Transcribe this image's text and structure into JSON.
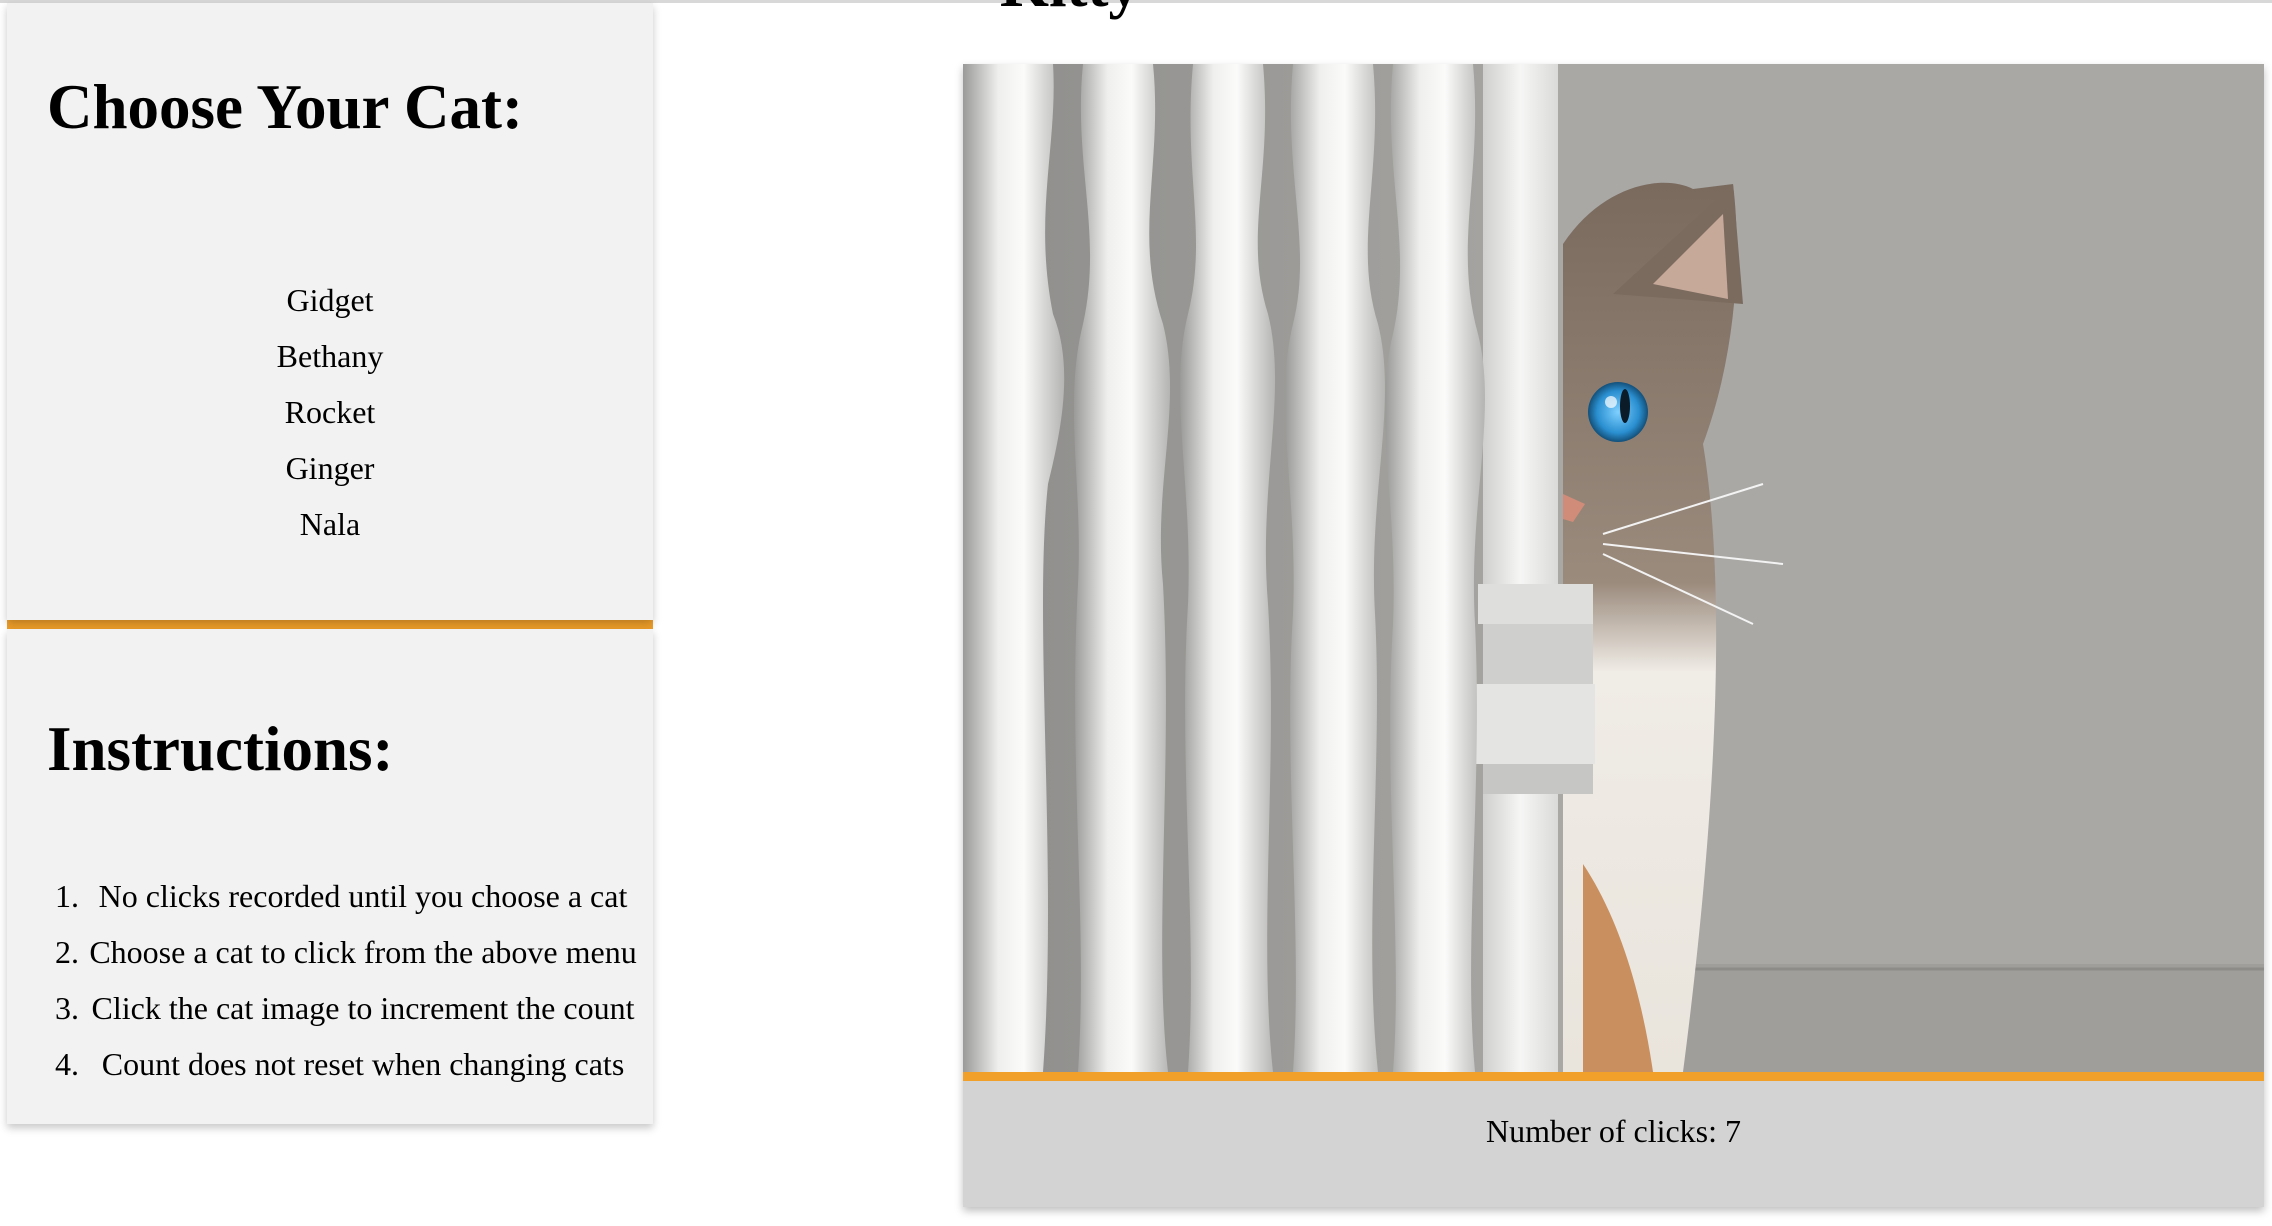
{
  "main": {
    "heading_partial": "Kitty",
    "click_label": "Number of clicks:",
    "click_count": "7",
    "colors": {
      "accent": "#f1a02a",
      "panel": "#f2f2f2",
      "counter_bg": "#d3d3d3"
    },
    "image": {
      "icon": "cat-photo",
      "content": "cat peeking around white stair balusters"
    }
  },
  "sidebar": {
    "menu_title": "Choose Your Cat:",
    "cats": [
      "Gidget",
      "Bethany",
      "Rocket",
      "Ginger",
      "Nala"
    ],
    "instructions_title": "Instructions:",
    "instructions": [
      {
        "num": "1.",
        "text": "No clicks recorded until you choose a cat"
      },
      {
        "num": "2.",
        "text": "Choose a cat to click from the above menu"
      },
      {
        "num": "3.",
        "text": "Click the cat image to increment the count"
      },
      {
        "num": "4.",
        "text": "Count does not reset when changing cats"
      }
    ]
  }
}
